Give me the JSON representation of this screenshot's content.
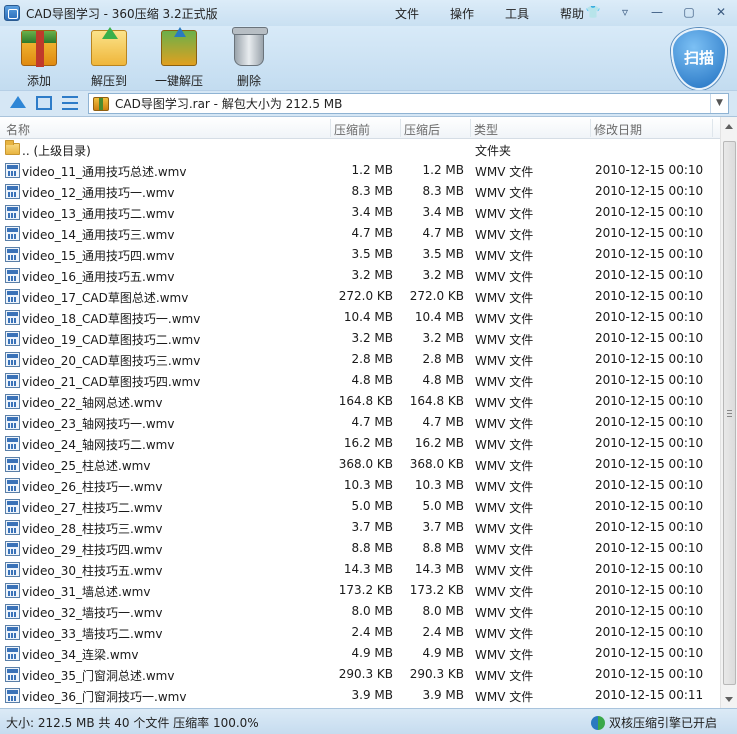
{
  "window": {
    "title": "CAD导图学习 - 360压缩 3.2正式版"
  },
  "menu": {
    "file": "文件",
    "operate": "操作",
    "tools": "工具",
    "help": "帮助"
  },
  "toolbar": {
    "add": "添加",
    "extract_to": "解压到",
    "one_key_extract": "一键解压",
    "delete": "删除",
    "scan": "扫描"
  },
  "address": {
    "path": "CAD导图学习.rar - 解包大小为 212.5 MB"
  },
  "columns": {
    "name": "名称",
    "compressed": "压缩前",
    "uncompressed": "压缩后",
    "type": "类型",
    "modified": "修改日期"
  },
  "parent_row": {
    "name": ".. (上级目录)",
    "type": "文件夹"
  },
  "files": [
    {
      "name": "video_11_通用技巧总述.wmv",
      "before": "1.2 MB",
      "after": "1.2 MB",
      "type": "WMV 文件",
      "date": "2010-12-15 00:10"
    },
    {
      "name": "video_12_通用技巧一.wmv",
      "before": "8.3 MB",
      "after": "8.3 MB",
      "type": "WMV 文件",
      "date": "2010-12-15 00:10"
    },
    {
      "name": "video_13_通用技巧二.wmv",
      "before": "3.4 MB",
      "after": "3.4 MB",
      "type": "WMV 文件",
      "date": "2010-12-15 00:10"
    },
    {
      "name": "video_14_通用技巧三.wmv",
      "before": "4.7 MB",
      "after": "4.7 MB",
      "type": "WMV 文件",
      "date": "2010-12-15 00:10"
    },
    {
      "name": "video_15_通用技巧四.wmv",
      "before": "3.5 MB",
      "after": "3.5 MB",
      "type": "WMV 文件",
      "date": "2010-12-15 00:10"
    },
    {
      "name": "video_16_通用技巧五.wmv",
      "before": "3.2 MB",
      "after": "3.2 MB",
      "type": "WMV 文件",
      "date": "2010-12-15 00:10"
    },
    {
      "name": "video_17_CAD草图总述.wmv",
      "before": "272.0 KB",
      "after": "272.0 KB",
      "type": "WMV 文件",
      "date": "2010-12-15 00:10"
    },
    {
      "name": "video_18_CAD草图技巧一.wmv",
      "before": "10.4 MB",
      "after": "10.4 MB",
      "type": "WMV 文件",
      "date": "2010-12-15 00:10"
    },
    {
      "name": "video_19_CAD草图技巧二.wmv",
      "before": "3.2 MB",
      "after": "3.2 MB",
      "type": "WMV 文件",
      "date": "2010-12-15 00:10"
    },
    {
      "name": "video_20_CAD草图技巧三.wmv",
      "before": "2.8 MB",
      "after": "2.8 MB",
      "type": "WMV 文件",
      "date": "2010-12-15 00:10"
    },
    {
      "name": "video_21_CAD草图技巧四.wmv",
      "before": "4.8 MB",
      "after": "4.8 MB",
      "type": "WMV 文件",
      "date": "2010-12-15 00:10"
    },
    {
      "name": "video_22_轴网总述.wmv",
      "before": "164.8 KB",
      "after": "164.8 KB",
      "type": "WMV 文件",
      "date": "2010-12-15 00:10"
    },
    {
      "name": "video_23_轴网技巧一.wmv",
      "before": "4.7 MB",
      "after": "4.7 MB",
      "type": "WMV 文件",
      "date": "2010-12-15 00:10"
    },
    {
      "name": "video_24_轴网技巧二.wmv",
      "before": "16.2 MB",
      "after": "16.2 MB",
      "type": "WMV 文件",
      "date": "2010-12-15 00:10"
    },
    {
      "name": "video_25_柱总述.wmv",
      "before": "368.0 KB",
      "after": "368.0 KB",
      "type": "WMV 文件",
      "date": "2010-12-15 00:10"
    },
    {
      "name": "video_26_柱技巧一.wmv",
      "before": "10.3 MB",
      "after": "10.3 MB",
      "type": "WMV 文件",
      "date": "2010-12-15 00:10"
    },
    {
      "name": "video_27_柱技巧二.wmv",
      "before": "5.0 MB",
      "after": "5.0 MB",
      "type": "WMV 文件",
      "date": "2010-12-15 00:10"
    },
    {
      "name": "video_28_柱技巧三.wmv",
      "before": "3.7 MB",
      "after": "3.7 MB",
      "type": "WMV 文件",
      "date": "2010-12-15 00:10"
    },
    {
      "name": "video_29_柱技巧四.wmv",
      "before": "8.8 MB",
      "after": "8.8 MB",
      "type": "WMV 文件",
      "date": "2010-12-15 00:10"
    },
    {
      "name": "video_30_柱技巧五.wmv",
      "before": "14.3 MB",
      "after": "14.3 MB",
      "type": "WMV 文件",
      "date": "2010-12-15 00:10"
    },
    {
      "name": "video_31_墙总述.wmv",
      "before": "173.2 KB",
      "after": "173.2 KB",
      "type": "WMV 文件",
      "date": "2010-12-15 00:10"
    },
    {
      "name": "video_32_墙技巧一.wmv",
      "before": "8.0 MB",
      "after": "8.0 MB",
      "type": "WMV 文件",
      "date": "2010-12-15 00:10"
    },
    {
      "name": "video_33_墙技巧二.wmv",
      "before": "2.4 MB",
      "after": "2.4 MB",
      "type": "WMV 文件",
      "date": "2010-12-15 00:10"
    },
    {
      "name": "video_34_连梁.wmv",
      "before": "4.9 MB",
      "after": "4.9 MB",
      "type": "WMV 文件",
      "date": "2010-12-15 00:10"
    },
    {
      "name": "video_35_门窗洞总述.wmv",
      "before": "290.3 KB",
      "after": "290.3 KB",
      "type": "WMV 文件",
      "date": "2010-12-15 00:10"
    },
    {
      "name": "video_36_门窗洞技巧一.wmv",
      "before": "3.9 MB",
      "after": "3.9 MB",
      "type": "WMV 文件",
      "date": "2010-12-15 00:11"
    }
  ],
  "status": {
    "summary": "大小: 212.5 MB 共 40 个文件 压缩率 100.0%",
    "engine": "双核压缩引擎已开启"
  }
}
